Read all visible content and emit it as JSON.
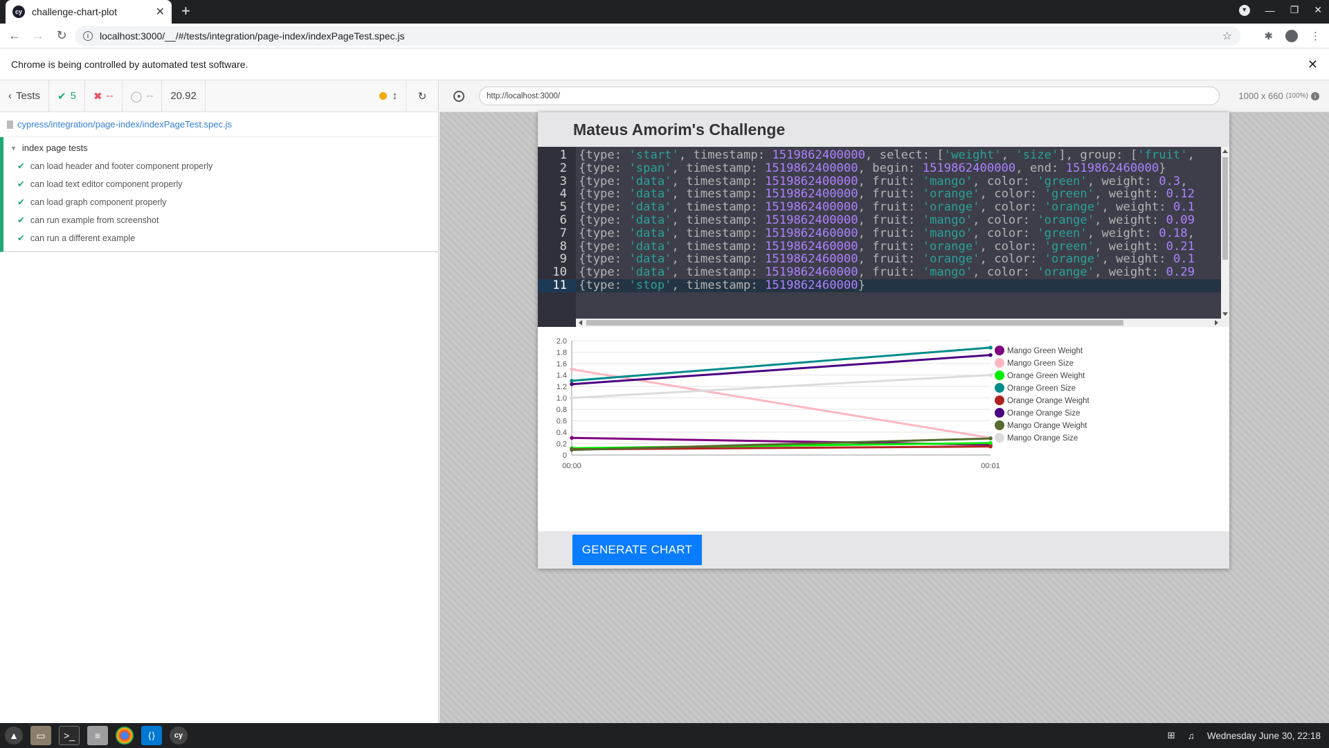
{
  "browser": {
    "tab_title": "challenge-chart-plot",
    "url": "localhost:3000/__/#/tests/integration/page-index/indexPageTest.spec.js",
    "automation_notice": "Chrome is being controlled by automated test software."
  },
  "reporter": {
    "tests_label": "Tests",
    "passed": "5",
    "failed": "--",
    "pending": "--",
    "duration": "20.92",
    "spec_path": "cypress/integration/page-index/indexPageTest.spec.js",
    "suite_title": "index page tests",
    "tests": [
      "can load header and footer component properly",
      "can load text editor component properly",
      "can load graph component properly",
      "can run example from screenshot",
      "can run a different example"
    ]
  },
  "aut": {
    "url": "http://localhost:3000/",
    "viewport": "1000 x 660",
    "zoom": "(100%)"
  },
  "app": {
    "title": "Mateus Amorim's Challenge",
    "button_label": "GENERATE CHART",
    "editor_lines": [
      [
        [
          "p",
          "{type: "
        ],
        [
          "s",
          "'start'"
        ],
        [
          "p",
          ", timestamp: "
        ],
        [
          "n",
          "1519862400000"
        ],
        [
          "p",
          ", select: ["
        ],
        [
          "s",
          "'weight'"
        ],
        [
          "p",
          ", "
        ],
        [
          "s",
          "'size'"
        ],
        [
          "p",
          "], group: ["
        ],
        [
          "s",
          "'fruit'"
        ],
        [
          "p",
          ","
        ]
      ],
      [
        [
          "p",
          "{type: "
        ],
        [
          "s",
          "'span'"
        ],
        [
          "p",
          ", timestamp: "
        ],
        [
          "n",
          "1519862400000"
        ],
        [
          "p",
          ", begin: "
        ],
        [
          "n",
          "1519862400000"
        ],
        [
          "p",
          ", end: "
        ],
        [
          "n",
          "1519862460000"
        ],
        [
          "p",
          "}"
        ]
      ],
      [
        [
          "p",
          "{type: "
        ],
        [
          "s",
          "'data'"
        ],
        [
          "p",
          ", timestamp: "
        ],
        [
          "n",
          "1519862400000"
        ],
        [
          "p",
          ", fruit: "
        ],
        [
          "s",
          "'mango'"
        ],
        [
          "p",
          ", color: "
        ],
        [
          "s",
          "'green'"
        ],
        [
          "p",
          ", weight: "
        ],
        [
          "n",
          "0.3"
        ],
        [
          "p",
          ","
        ]
      ],
      [
        [
          "p",
          "{type: "
        ],
        [
          "s",
          "'data'"
        ],
        [
          "p",
          ", timestamp: "
        ],
        [
          "n",
          "1519862400000"
        ],
        [
          "p",
          ", fruit: "
        ],
        [
          "s",
          "'orange'"
        ],
        [
          "p",
          ", color: "
        ],
        [
          "s",
          "'green'"
        ],
        [
          "p",
          ", weight: "
        ],
        [
          "n",
          "0.12"
        ]
      ],
      [
        [
          "p",
          "{type: "
        ],
        [
          "s",
          "'data'"
        ],
        [
          "p",
          ", timestamp: "
        ],
        [
          "n",
          "1519862400000"
        ],
        [
          "p",
          ", fruit: "
        ],
        [
          "s",
          "'orange'"
        ],
        [
          "p",
          ", color: "
        ],
        [
          "s",
          "'orange'"
        ],
        [
          "p",
          ", weight: "
        ],
        [
          "n",
          "0.1"
        ]
      ],
      [
        [
          "p",
          "{type: "
        ],
        [
          "s",
          "'data'"
        ],
        [
          "p",
          ", timestamp: "
        ],
        [
          "n",
          "1519862400000"
        ],
        [
          "p",
          ", fruit: "
        ],
        [
          "s",
          "'mango'"
        ],
        [
          "p",
          ", color: "
        ],
        [
          "s",
          "'orange'"
        ],
        [
          "p",
          ", weight: "
        ],
        [
          "n",
          "0.09"
        ]
      ],
      [
        [
          "p",
          "{type: "
        ],
        [
          "s",
          "'data'"
        ],
        [
          "p",
          ", timestamp: "
        ],
        [
          "n",
          "1519862460000"
        ],
        [
          "p",
          ", fruit: "
        ],
        [
          "s",
          "'mango'"
        ],
        [
          "p",
          ", color: "
        ],
        [
          "s",
          "'green'"
        ],
        [
          "p",
          ", weight: "
        ],
        [
          "n",
          "0.18"
        ],
        [
          "p",
          ","
        ]
      ],
      [
        [
          "p",
          "{type: "
        ],
        [
          "s",
          "'data'"
        ],
        [
          "p",
          ", timestamp: "
        ],
        [
          "n",
          "1519862460000"
        ],
        [
          "p",
          ", fruit: "
        ],
        [
          "s",
          "'orange'"
        ],
        [
          "p",
          ", color: "
        ],
        [
          "s",
          "'green'"
        ],
        [
          "p",
          ", weight: "
        ],
        [
          "n",
          "0.21"
        ]
      ],
      [
        [
          "p",
          "{type: "
        ],
        [
          "s",
          "'data'"
        ],
        [
          "p",
          ", timestamp: "
        ],
        [
          "n",
          "1519862460000"
        ],
        [
          "p",
          ", fruit: "
        ],
        [
          "s",
          "'orange'"
        ],
        [
          "p",
          ", color: "
        ],
        [
          "s",
          "'orange'"
        ],
        [
          "p",
          ", weight: "
        ],
        [
          "n",
          "0.1"
        ]
      ],
      [
        [
          "p",
          "{type: "
        ],
        [
          "s",
          "'data'"
        ],
        [
          "p",
          ", timestamp: "
        ],
        [
          "n",
          "1519862460000"
        ],
        [
          "p",
          ", fruit: "
        ],
        [
          "s",
          "'mango'"
        ],
        [
          "p",
          ", color: "
        ],
        [
          "s",
          "'orange'"
        ],
        [
          "p",
          ", weight: "
        ],
        [
          "n",
          "0.29"
        ]
      ],
      [
        [
          "p",
          "{type: "
        ],
        [
          "s",
          "'stop'"
        ],
        [
          "p",
          ", timestamp: "
        ],
        [
          "n",
          "1519862460000"
        ],
        [
          "p",
          "}"
        ]
      ]
    ]
  },
  "chart_data": {
    "type": "line",
    "x": [
      "00:00",
      "00:01"
    ],
    "ylim": [
      0,
      2
    ],
    "yticks": [
      "0",
      "0.2",
      "0.4",
      "0.6",
      "0.8",
      "1.0",
      "1.2",
      "1.4",
      "1.6",
      "1.8",
      "2.0"
    ],
    "grid": true,
    "legend_position": "right",
    "series": [
      {
        "name": "Mango Green Weight",
        "color": "#800080",
        "values": [
          0.3,
          0.18
        ]
      },
      {
        "name": "Mango Green Size",
        "color": "#ffb6c1",
        "values": [
          1.5,
          0.3
        ]
      },
      {
        "name": "Orange Green Weight",
        "color": "#00ee00",
        "values": [
          0.12,
          0.21
        ]
      },
      {
        "name": "Orange Green Size",
        "color": "#008b8b",
        "values": [
          1.3,
          1.88
        ]
      },
      {
        "name": "Orange Orange Weight",
        "color": "#b22222",
        "values": [
          0.1,
          0.15
        ]
      },
      {
        "name": "Orange Orange Size",
        "color": "#4b0082",
        "values": [
          1.24,
          1.75
        ]
      },
      {
        "name": "Mango Orange Weight",
        "color": "#556b2f",
        "values": [
          0.09,
          0.29
        ]
      },
      {
        "name": "Mango Orange Size",
        "color": "#dcdcdc",
        "values": [
          1.0,
          1.4
        ]
      }
    ]
  },
  "taskbar": {
    "clock": "Wednesday June 30, 22:18"
  }
}
